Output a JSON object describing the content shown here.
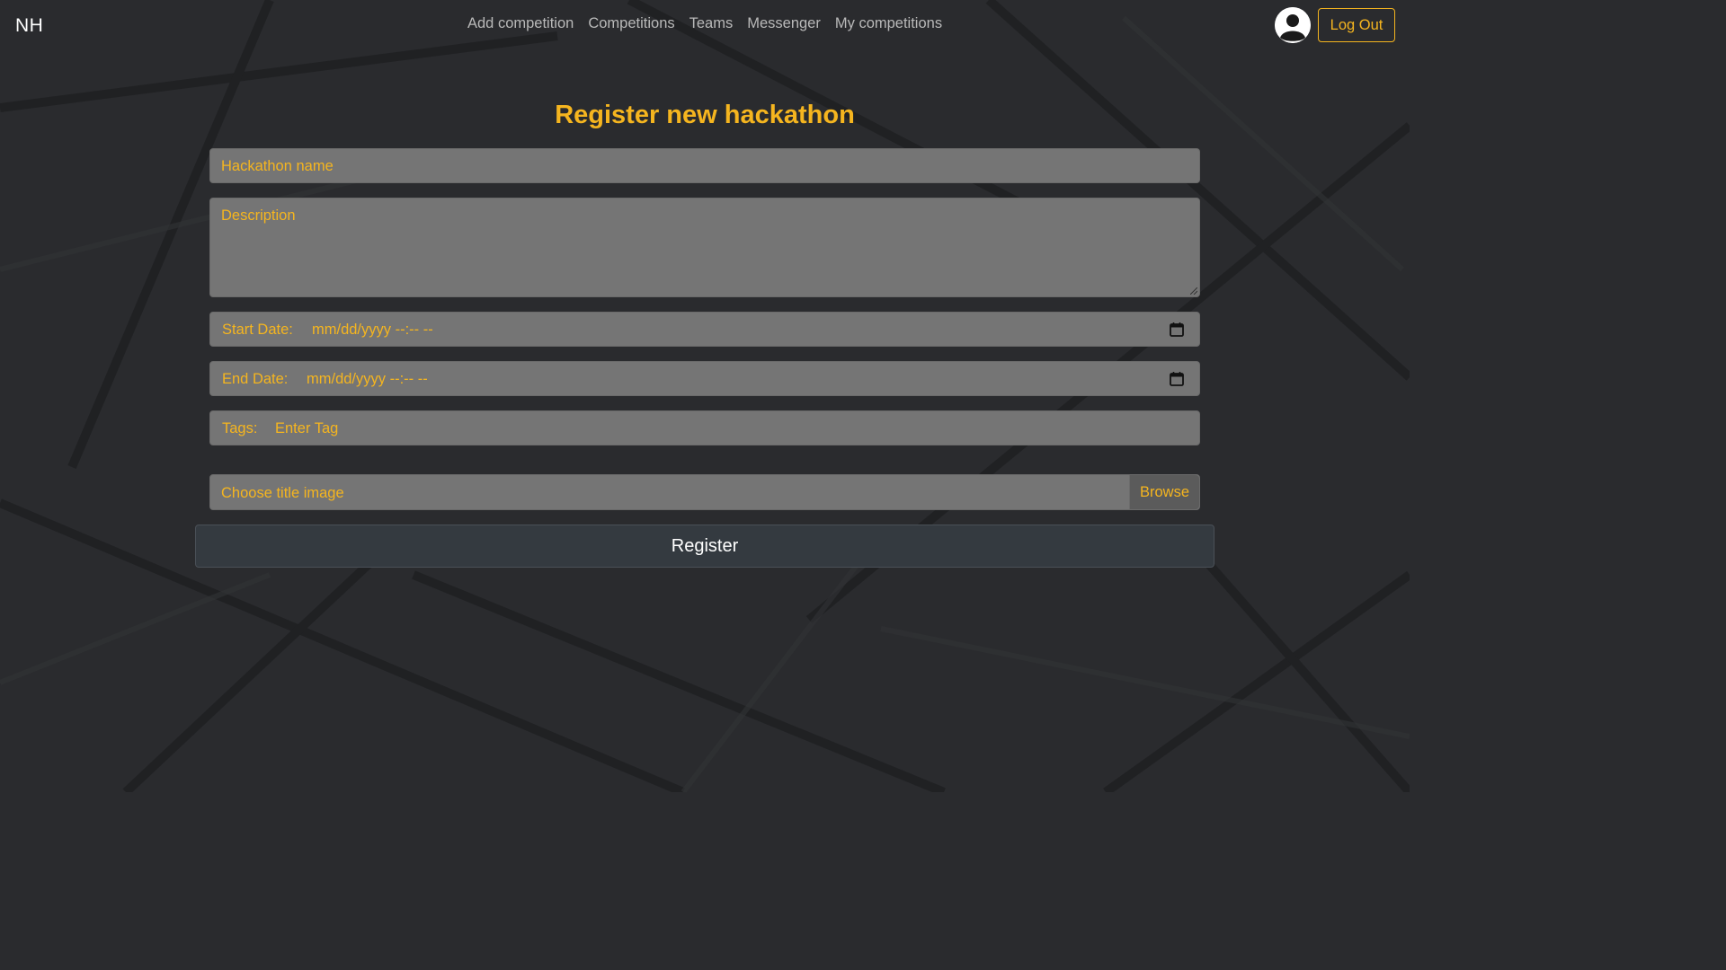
{
  "navbar": {
    "brand": "NH",
    "links": [
      "Add competition",
      "Competitions",
      "Teams",
      "Messenger",
      "My competitions"
    ],
    "logout_label": "Log Out"
  },
  "form": {
    "title": "Register new hackathon",
    "name_placeholder": "Hackathon name",
    "description_placeholder": "Description",
    "start_label": "Start Date:",
    "start_value": "mm/dd/yyyy --:-- --",
    "end_label": "End Date:",
    "end_value": "mm/dd/yyyy --:-- --",
    "tags_label": "Tags:",
    "tags_placeholder": "Enter Tag",
    "image_placeholder": "Choose title image",
    "browse_label": "Browse",
    "submit_label": "Register"
  },
  "colors": {
    "accent": "#f5b51f",
    "background": "#2a2b2e",
    "field": "#757575",
    "button": "#343a40"
  }
}
